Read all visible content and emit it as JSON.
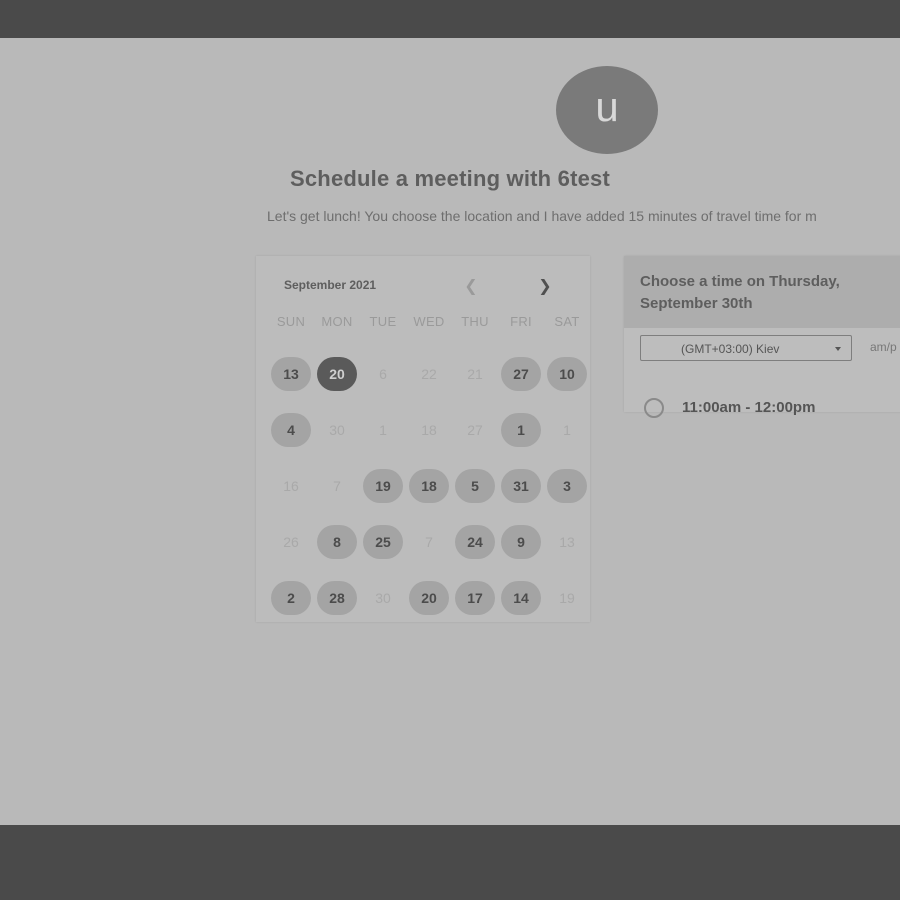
{
  "avatar": {
    "letter": "u"
  },
  "title": "Schedule a meeting with 6test",
  "description": "Let's get lunch! You choose the location and I have added 15 minutes of travel time for m",
  "calendar": {
    "month": "September 2021",
    "prev_icon": "chevron-left-icon",
    "next_icon": "chevron-right-icon",
    "weekdays": [
      "SUN",
      "MON",
      "TUE",
      "WED",
      "THU",
      "FRI",
      "SAT"
    ],
    "rows": [
      [
        {
          "label": "13",
          "state": "available"
        },
        {
          "label": "20",
          "state": "selected"
        },
        {
          "label": "6",
          "state": "unavailable"
        },
        {
          "label": "22",
          "state": "unavailable"
        },
        {
          "label": "21",
          "state": "unavailable"
        },
        {
          "label": "27",
          "state": "available"
        },
        {
          "label": "10",
          "state": "available"
        }
      ],
      [
        {
          "label": "4",
          "state": "available"
        },
        {
          "label": "30",
          "state": "unavailable"
        },
        {
          "label": "1",
          "state": "unavailable"
        },
        {
          "label": "18",
          "state": "unavailable"
        },
        {
          "label": "27",
          "state": "unavailable"
        },
        {
          "label": "1",
          "state": "available"
        },
        {
          "label": "1",
          "state": "unavailable"
        }
      ],
      [
        {
          "label": "16",
          "state": "unavailable"
        },
        {
          "label": "7",
          "state": "unavailable"
        },
        {
          "label": "19",
          "state": "available"
        },
        {
          "label": "18",
          "state": "available"
        },
        {
          "label": "5",
          "state": "available"
        },
        {
          "label": "31",
          "state": "available"
        },
        {
          "label": "3",
          "state": "available"
        }
      ],
      [
        {
          "label": "26",
          "state": "unavailable"
        },
        {
          "label": "8",
          "state": "available"
        },
        {
          "label": "25",
          "state": "available"
        },
        {
          "label": "7",
          "state": "unavailable"
        },
        {
          "label": "24",
          "state": "available"
        },
        {
          "label": "9",
          "state": "available"
        },
        {
          "label": "13",
          "state": "unavailable"
        }
      ],
      [
        {
          "label": "2",
          "state": "available"
        },
        {
          "label": "28",
          "state": "available"
        },
        {
          "label": "30",
          "state": "unavailable"
        },
        {
          "label": "20",
          "state": "available"
        },
        {
          "label": "17",
          "state": "available"
        },
        {
          "label": "14",
          "state": "available"
        },
        {
          "label": "19",
          "state": "unavailable"
        }
      ]
    ]
  },
  "time_panel": {
    "title": "Choose a time on Thursday, September 30th",
    "timezone": "(GMT+03:00) Kiev",
    "format_toggle": "am/p",
    "slots": [
      {
        "label": "11:00am - 12:00pm"
      }
    ]
  }
}
